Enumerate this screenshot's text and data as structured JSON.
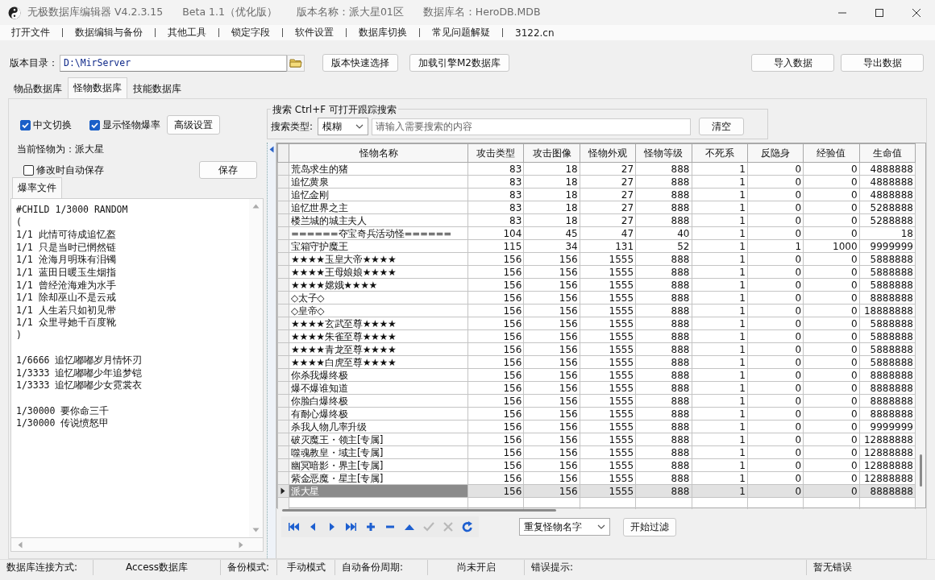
{
  "window": {
    "title": "无极数据库编辑器 V4.2.3.15",
    "edition": "Beta 1.1（优化版）",
    "version_name": "版本名称：派大星01区",
    "database_name": "数据库名：HeroDB.MDB"
  },
  "menu": [
    "打开文件",
    "数据编辑与备份",
    "其他工具",
    "锁定字段",
    "软件设置",
    "数据库切换",
    "常见问题解疑",
    "3122.cn"
  ],
  "toolbar": {
    "dir_label": "版本目录：",
    "dir_value": "D:\\MirServer",
    "buttons": [
      "版本快速选择",
      "加载引擎M2数据库"
    ],
    "right_buttons": [
      "导入数据",
      "导出数据"
    ]
  },
  "tabs": [
    {
      "label": "物品数据库",
      "selected": false
    },
    {
      "label": "怪物数据库",
      "selected": true
    },
    {
      "label": "技能数据库",
      "selected": false
    }
  ],
  "options": {
    "checkboxes": [
      {
        "label": "中文切换",
        "checked": true
      },
      {
        "label": "显示怪物爆率",
        "checked": true
      }
    ],
    "button": "高级设置"
  },
  "search": {
    "legend": "搜索  Ctrl+F 可打开跟踪搜索",
    "type_label": "搜索类型:",
    "type_value": "模糊",
    "placeholder": "请输入需要搜索的内容",
    "clear_button": "清空"
  },
  "current_monster": {
    "label": "当前怪物为：派大星",
    "autosave": {
      "label": "修改时自动保存",
      "checked": false
    },
    "save_button": "保存"
  },
  "drop_file": {
    "tab": "爆率文件",
    "blocks": [
      [
        "#CHILD 1/3000 RANDOM",
        "(",
        "1/1 此情可待成追忆盔",
        "1/1 只是当时已惘然链",
        "1/1 沧海月明珠有泪镯",
        "1/1 蓝田日暖玉生烟指",
        "1/1 曾经沧海难为水手",
        "1/1 除却巫山不是云戒",
        "1/1 人生若只如初见带",
        "1/1 众里寻她千百度靴",
        ")"
      ],
      [
        "1/6666 追忆嘟嘟岁月情怀刃",
        "1/3333 追忆嘟嘟少年追梦铠",
        "1/3333 追忆嘟嘟少女霓裳衣"
      ],
      [
        "1/30000 要你命三千",
        "1/30000 传说愤怒甲"
      ]
    ]
  },
  "table": {
    "columns": [
      "怪物名称",
      "攻击类型",
      "攻击图像",
      "怪物外观",
      "怪物等级",
      "不死系",
      "反隐身",
      "经验值",
      "生命值"
    ],
    "rows": [
      {
        "selected": false,
        "cells": [
          "荒岛求生的猪",
          "83",
          "18",
          "27",
          "888",
          "1",
          "0",
          "0",
          "4888888"
        ]
      },
      {
        "selected": false,
        "cells": [
          "追忆黄泉",
          "83",
          "18",
          "27",
          "888",
          "1",
          "0",
          "0",
          "4888888"
        ]
      },
      {
        "selected": false,
        "cells": [
          "追忆金刚",
          "83",
          "18",
          "27",
          "888",
          "1",
          "0",
          "0",
          "4888888"
        ]
      },
      {
        "selected": false,
        "cells": [
          "追忆世界之主",
          "83",
          "18",
          "27",
          "888",
          "1",
          "0",
          "0",
          "5288888"
        ]
      },
      {
        "selected": false,
        "cells": [
          "楼兰城的城主夫人",
          "83",
          "18",
          "27",
          "888",
          "1",
          "0",
          "0",
          "5288888"
        ]
      },
      {
        "selected": false,
        "cells": [
          "======夺宝奇兵活动怪======",
          "104",
          "45",
          "47",
          "40",
          "1",
          "0",
          "0",
          "18"
        ]
      },
      {
        "selected": false,
        "cells": [
          "宝箱守护魔王",
          "115",
          "34",
          "131",
          "52",
          "1",
          "1",
          "1000",
          "9999999"
        ]
      },
      {
        "selected": false,
        "cells": [
          "★★★★玉皇大帝★★★★",
          "156",
          "156",
          "1555",
          "888",
          "1",
          "0",
          "0",
          "5888888"
        ]
      },
      {
        "selected": false,
        "cells": [
          "★★★★王母娘娘★★★★",
          "156",
          "156",
          "1555",
          "888",
          "1",
          "0",
          "0",
          "5888888"
        ]
      },
      {
        "selected": false,
        "cells": [
          "★★★★嫦娥★★★★",
          "156",
          "156",
          "1555",
          "888",
          "1",
          "0",
          "0",
          "5888888"
        ]
      },
      {
        "selected": false,
        "cells": [
          "◇太子◇",
          "156",
          "156",
          "1555",
          "888",
          "1",
          "0",
          "0",
          "8888888"
        ]
      },
      {
        "selected": false,
        "cells": [
          "◇皇帝◇",
          "156",
          "156",
          "1555",
          "888",
          "1",
          "0",
          "0",
          "18888888"
        ]
      },
      {
        "selected": false,
        "cells": [
          "★★★★玄武至尊★★★★",
          "156",
          "156",
          "1555",
          "888",
          "1",
          "0",
          "0",
          "5888888"
        ]
      },
      {
        "selected": false,
        "cells": [
          "★★★★朱雀至尊★★★★",
          "156",
          "156",
          "1555",
          "888",
          "1",
          "0",
          "0",
          "5888888"
        ]
      },
      {
        "selected": false,
        "cells": [
          "★★★★青龙至尊★★★★",
          "156",
          "156",
          "1555",
          "888",
          "1",
          "0",
          "0",
          "5888888"
        ]
      },
      {
        "selected": false,
        "cells": [
          "★★★★白虎至尊★★★★",
          "156",
          "156",
          "1555",
          "888",
          "1",
          "0",
          "0",
          "5888888"
        ]
      },
      {
        "selected": false,
        "cells": [
          "你杀我爆终极",
          "156",
          "156",
          "1555",
          "888",
          "1",
          "0",
          "0",
          "8888888"
        ]
      },
      {
        "selected": false,
        "cells": [
          "爆不爆谁知道",
          "156",
          "156",
          "1555",
          "888",
          "1",
          "0",
          "0",
          "8888888"
        ]
      },
      {
        "selected": false,
        "cells": [
          "你脸白爆终极",
          "156",
          "156",
          "1555",
          "888",
          "1",
          "0",
          "0",
          "8888888"
        ]
      },
      {
        "selected": false,
        "cells": [
          "有耐心爆终极",
          "156",
          "156",
          "1555",
          "888",
          "1",
          "0",
          "0",
          "8888888"
        ]
      },
      {
        "selected": false,
        "cells": [
          "杀我人物几率升级",
          "156",
          "156",
          "1555",
          "888",
          "1",
          "0",
          "0",
          "9999999"
        ]
      },
      {
        "selected": false,
        "cells": [
          "破灭魔王・领主[专属]",
          "156",
          "156",
          "1555",
          "888",
          "1",
          "0",
          "0",
          "12888888"
        ]
      },
      {
        "selected": false,
        "cells": [
          "噬魂教皇・域主[专属]",
          "156",
          "156",
          "1555",
          "888",
          "1",
          "0",
          "0",
          "12888888"
        ]
      },
      {
        "selected": false,
        "cells": [
          "幽冥暗影・界主[专属]",
          "156",
          "156",
          "1555",
          "888",
          "1",
          "0",
          "0",
          "12888888"
        ]
      },
      {
        "selected": false,
        "cells": [
          "紫金恶魔・星主[专属]",
          "156",
          "156",
          "1555",
          "888",
          "1",
          "0",
          "0",
          "12888888"
        ]
      },
      {
        "selected": true,
        "cells": [
          "派大星",
          "156",
          "156",
          "1555",
          "888",
          "1",
          "0",
          "0",
          "8888888"
        ]
      }
    ]
  },
  "navigator": [
    {
      "kind": "first",
      "disabled": false
    },
    {
      "kind": "prior",
      "disabled": false
    },
    {
      "kind": "next",
      "disabled": false
    },
    {
      "kind": "last",
      "disabled": false
    },
    {
      "kind": "insert",
      "disabled": false
    },
    {
      "kind": "delete",
      "disabled": false
    },
    {
      "kind": "edit",
      "disabled": false
    },
    {
      "kind": "post",
      "disabled": true
    },
    {
      "kind": "cancel",
      "disabled": true
    },
    {
      "kind": "refresh",
      "disabled": false
    }
  ],
  "filter": {
    "dropdown": "重复怪物名字",
    "button": "开始过滤"
  },
  "status_bar": [
    "数据库连接方式:",
    "Access数据库",
    "备份模式:",
    "手动模式",
    "自动备份周期:",
    "尚未开启",
    "错误提示:",
    "暂无错误"
  ]
}
